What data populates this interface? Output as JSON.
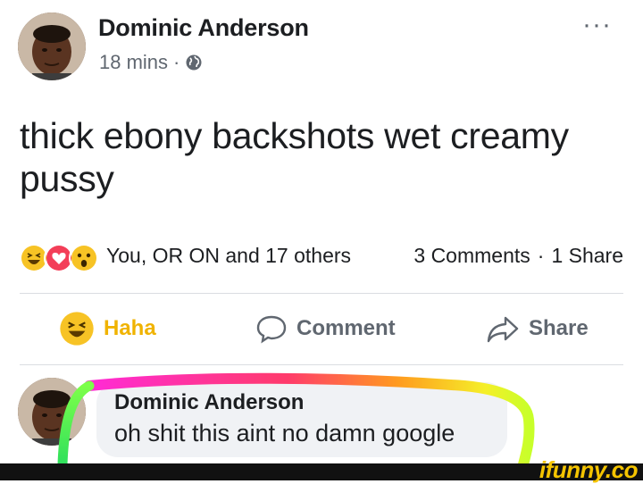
{
  "post": {
    "author": "Dominic Anderson",
    "time": "18 mins",
    "separator": "·",
    "privacy_icon": "globe-icon",
    "menu_label": "···",
    "text": "thick ebony backshots wet creamy pussy"
  },
  "reactions": {
    "icons": [
      "haha-icon",
      "love-icon",
      "wow-icon"
    ],
    "summary": "You, OR ON and 17 others",
    "comments": "3 Comments",
    "dot": "·",
    "shares": "1 Share"
  },
  "actions": {
    "haha": "Haha",
    "comment": "Comment",
    "share": "Share"
  },
  "comment": {
    "author": "Dominic Anderson",
    "text": "oh shit this aint no damn google"
  },
  "watermark": "ifunny.co",
  "colors": {
    "haha_accent": "#f0b300",
    "meta_gray": "#606770",
    "bubble_bg": "#f0f2f5"
  }
}
